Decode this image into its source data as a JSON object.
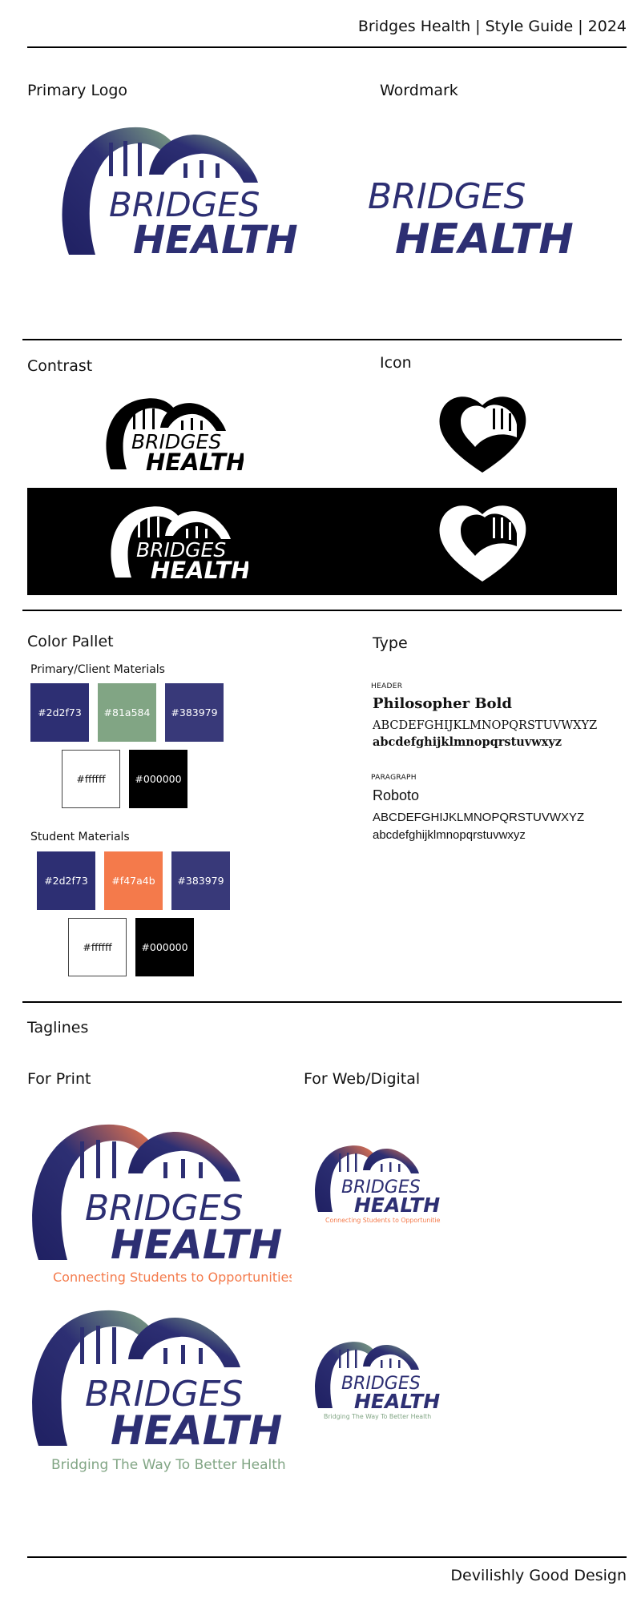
{
  "header": {
    "title": "Bridges Health | Style Guide | 2024"
  },
  "sections": {
    "primary_logo": "Primary Logo",
    "wordmark": "Wordmark",
    "contrast": "Contrast",
    "icon": "Icon",
    "color_pallet": "Color Pallet",
    "type": "Type",
    "taglines": "Taglines",
    "for_print": "For Print",
    "for_web": "For Web/Digital"
  },
  "brand": {
    "line1": "BRIDGES",
    "line2": "HEALTH",
    "navy": "#2d2f73",
    "green": "#81a584",
    "orange": "#f47a4b",
    "purple": "#383979"
  },
  "palette": {
    "primary_label": "Primary/Client Materials",
    "primary": [
      "#2d2f73",
      "#81a584",
      "#383979",
      "#ffffff",
      "#000000"
    ],
    "student_label": "Student Materials",
    "student": [
      "#2d2f73",
      "#f47a4b",
      "#383979",
      "#ffffff",
      "#000000"
    ]
  },
  "type": {
    "header_label": "HEADER",
    "header_font": "Philosopher Bold",
    "header_upper": "ABCDEFGHIJKLMNOPQRSTUVWXYZ",
    "header_lower": "abcdefghijklmnopqrstuvwxyz",
    "paragraph_label": "PARAGRAPH",
    "paragraph_font": "Roboto",
    "paragraph_upper": "ABCDEFGHIJKLMNOPQRSTUVWXYZ",
    "paragraph_lower": "abcdefghijklmnopqrstuvwxyz"
  },
  "taglines": {
    "students": "Connecting Students to Opportunities",
    "health": "Bridging The Way To Better Health"
  },
  "footer": {
    "credit": "Devilishly Good Design"
  }
}
